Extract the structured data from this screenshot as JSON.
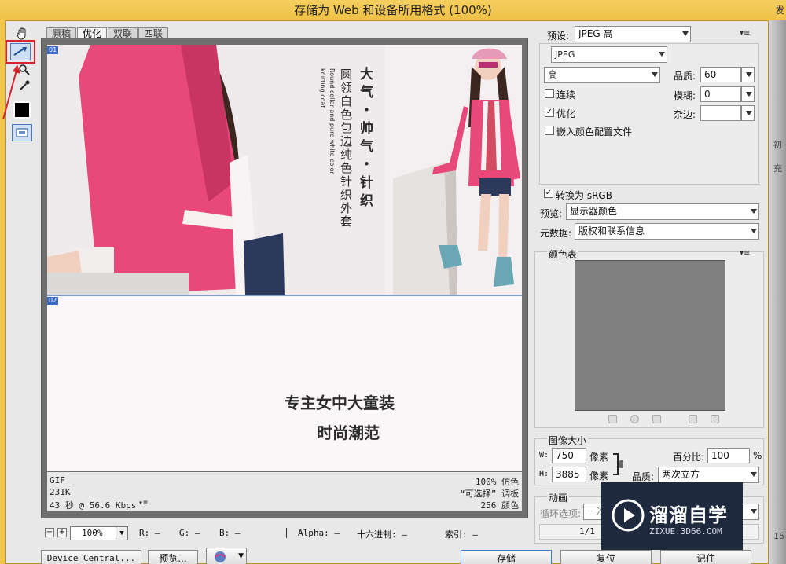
{
  "window": {
    "title": "存储为 Web 和设备所用格式 (100%)",
    "right_clip": "发"
  },
  "tabs": [
    "原稿",
    "优化",
    "双联",
    "四联"
  ],
  "active_tab": "优化",
  "slices": [
    "01",
    "02"
  ],
  "artwork": {
    "vertical_title": "大气・帅气・针织",
    "vertical_sub": "圆领白色包边纯色针织外套",
    "vertical_en1": "Round collar and pure white color",
    "vertical_en2": "knitting coat",
    "slogan1": "专主女中大童装",
    "slogan2": "时尚潮范"
  },
  "info": {
    "format": "GIF",
    "size": "231K",
    "time": "43 秒 @ 56.6 Kbps",
    "dither": "100% 仿色",
    "palette": "“可选择” 调板",
    "colors": "256 颜色"
  },
  "status": {
    "zoom": "100%",
    "r": "R: —",
    "g": "G: —",
    "b": "B: —",
    "alpha": "Alpha: —",
    "hex": "十六进制: —",
    "index": "索引: —"
  },
  "buttons": {
    "device_central": "Device Central...",
    "preview": "预览...",
    "save": "存储",
    "reset": "复位",
    "remember": "记住"
  },
  "settings": {
    "preset_label": "预设:",
    "preset_value": "JPEG 高",
    "format_value": "JPEG",
    "quality_level": "高",
    "quality_label": "品质:",
    "quality_value": "60",
    "progressive": "连续",
    "optimized": "优化",
    "embed_profile": "嵌入颜色配置文件",
    "blur_label": "模糊:",
    "blur_value": "0",
    "matte_label": "杂边:",
    "convert_srgb": "转换为 sRGB",
    "preview_label": "预览:",
    "preview_value": "显示器颜色",
    "metadata_label": "元数据:",
    "metadata_value": "版权和联系信息",
    "color_table": "颜色表",
    "image_size": "图像大小",
    "w_label": "W:",
    "w_value": "750",
    "h_label": "H:",
    "h_value": "3885",
    "px": "像素",
    "percent_label": "百分比:",
    "percent_value": "100",
    "percent_unit": "%",
    "resample_label": "品质:",
    "resample_value": "两次立方",
    "animation": "动画",
    "loop_label": "循环选项:",
    "loop_value": "一次",
    "frame": "1/1"
  },
  "watermark": {
    "cn": "溜溜自学",
    "url": "ZIXUE.3D66.COM"
  },
  "colors": {
    "accent_red": "#d9232e",
    "jacket_pink": "#e8487a",
    "swatch_gray": "#808080"
  }
}
